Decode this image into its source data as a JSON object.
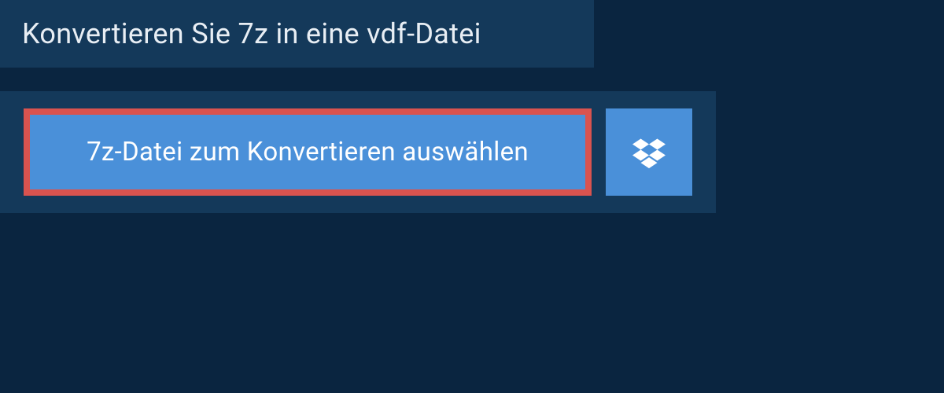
{
  "header": {
    "title": "Konvertieren Sie 7z in eine vdf-Datei"
  },
  "actions": {
    "select_file_label": "7z-Datei zum Konvertieren auswählen",
    "dropbox_icon": "dropbox-icon"
  },
  "colors": {
    "background": "#0a2540",
    "panel": "#14395a",
    "button": "#4a90d9",
    "highlight_border": "#d9534f",
    "text_light": "#e8eef4",
    "text_white": "#ffffff"
  }
}
